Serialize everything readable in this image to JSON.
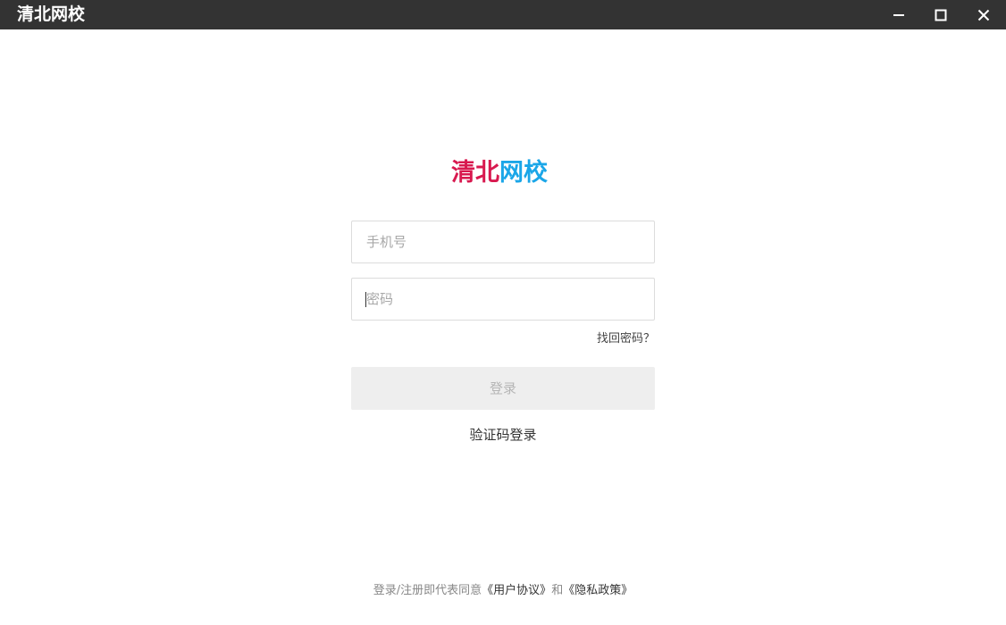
{
  "window": {
    "title": "清北网校",
    "controls": {
      "minimize_icon": "minimize-icon",
      "maximize_icon": "maximize-icon",
      "close_icon": "close-icon"
    },
    "titlebar_color": "#333333"
  },
  "logo": {
    "part_a": "清北",
    "part_b": "网校",
    "color_a": "#d8194f",
    "color_b": "#1aa6e8"
  },
  "form": {
    "phone": {
      "placeholder": "手机号",
      "value": ""
    },
    "password": {
      "placeholder": "密码",
      "value": ""
    },
    "forgot_label": "找回密码？",
    "login_label": "登录",
    "sms_login_label": "验证码登录"
  },
  "agreement": {
    "prefix": "登录/注册即代表同意",
    "user_agreement": "《用户协议》",
    "and": "和",
    "privacy_policy": "《隐私政策》"
  }
}
